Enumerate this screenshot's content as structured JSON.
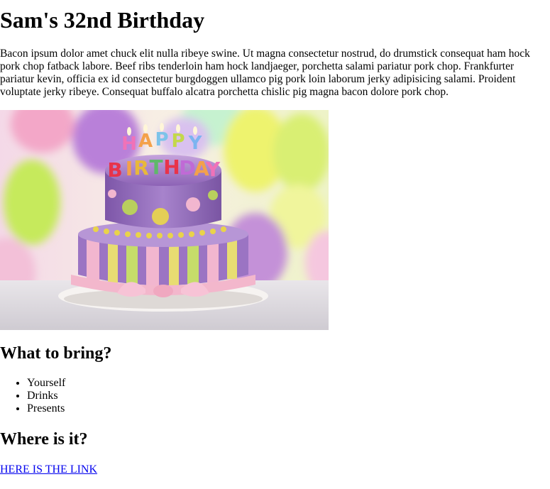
{
  "page": {
    "title": "Sam's 32nd Birthday",
    "intro": "Bacon ipsum dolor amet chuck elit nulla ribeye swine. Ut magna consectetur nostrud, do drumstick consequat ham hock pork chop fatback labore. Beef ribs tenderloin ham hock landjaeger, porchetta salami pariatur pork chop. Frankfurter pariatur kevin, officia ex id consectetur burgdoggen ullamco pig pork loin laborum jerky adipisicing salami. Proident voluptate jerky ribeye. Consequat buffalo alcatra porchetta chislic pig magna bacon dolore pork chop."
  },
  "image": {
    "candle_letters": [
      "H",
      "A",
      "P",
      "P",
      "Y",
      "B",
      "I",
      "R",
      "T",
      "H",
      "D",
      "A",
      "Y"
    ]
  },
  "bring": {
    "heading": "What to bring?",
    "items": [
      "Yourself",
      "Drinks",
      "Presents"
    ]
  },
  "where": {
    "heading": "Where is it?",
    "link_text": "HERE IS THE LINK"
  },
  "colors": {
    "link": "#0000ee",
    "text": "#000000",
    "background": "#ffffff"
  }
}
